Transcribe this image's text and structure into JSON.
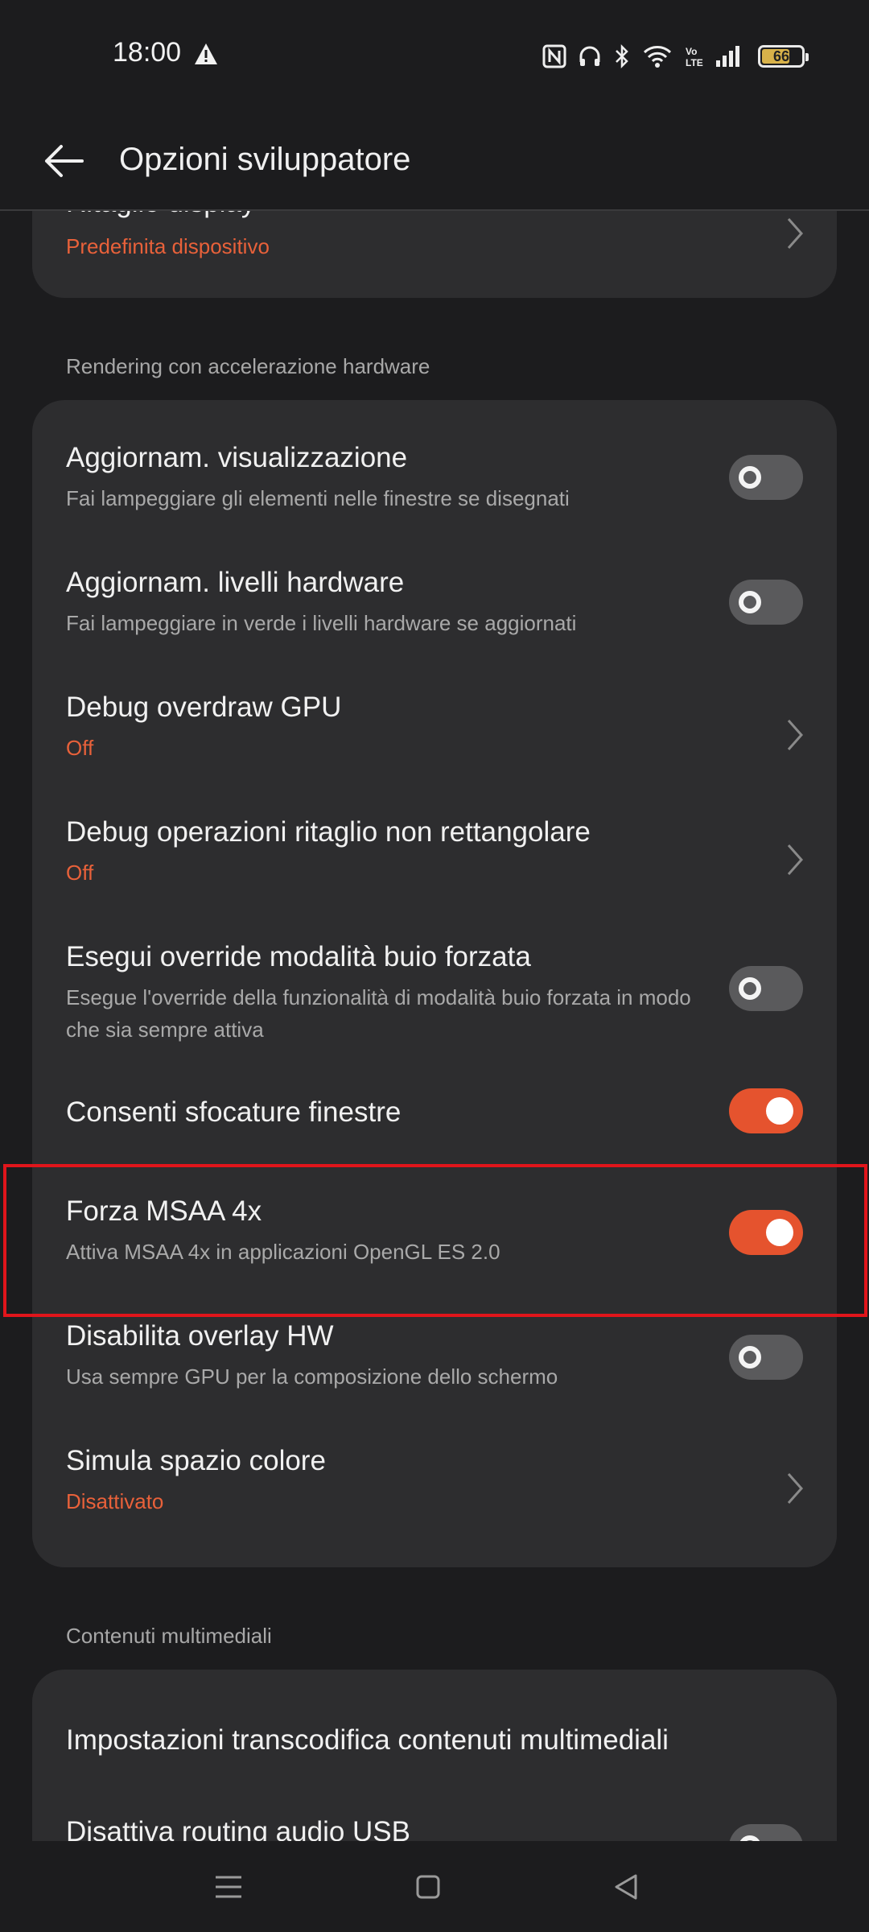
{
  "status_bar": {
    "time": "18:00",
    "battery_level": "66",
    "battery_fraction": 0.66,
    "icons": [
      "warning-icon",
      "nfc-icon",
      "headphones-icon",
      "bluetooth-icon",
      "wifi-icon",
      "volte-icon",
      "signal-icon",
      "battery-icon"
    ]
  },
  "app_bar": {
    "title": "Opzioni sviluppatore",
    "back_icon": "back-arrow-icon"
  },
  "top_card": {
    "title": "Ritaglio display",
    "subtitle": "Predefinita dispositivo"
  },
  "rendering": {
    "header": "Rendering con accelerazione hardware",
    "items": [
      {
        "title": "Aggiornam. visualizzazione",
        "subtitle": "Fai lampeggiare gli elementi nelle finestre se disegnati",
        "control": "toggle",
        "on": false
      },
      {
        "title": "Aggiornam. livelli hardware",
        "subtitle": "Fai lampeggiare in verde i livelli hardware se aggiornati",
        "control": "toggle",
        "on": false
      },
      {
        "title": "Debug overdraw GPU",
        "subtitle": "Off",
        "control": "chevron"
      },
      {
        "title": "Debug operazioni ritaglio non rettangolare",
        "subtitle": "Off",
        "control": "chevron"
      },
      {
        "title": "Esegui override modalità buio forzata",
        "subtitle": "Esegue l'override della funzionalità di modalità buio forzata in modo che sia sempre attiva",
        "control": "toggle",
        "on": false
      },
      {
        "title": "Consenti sfocature finestre",
        "subtitle": "",
        "control": "toggle",
        "on": true
      },
      {
        "title": "Forza MSAA 4x",
        "subtitle": "Attiva MSAA 4x in applicazioni OpenGL ES 2.0",
        "control": "toggle",
        "on": true
      },
      {
        "title": "Disabilita overlay HW",
        "subtitle": "Usa sempre GPU per la composizione dello schermo",
        "control": "toggle",
        "on": false
      },
      {
        "title": "Simula spazio colore",
        "subtitle": "Disattivato",
        "control": "chevron"
      }
    ]
  },
  "media": {
    "header": "Contenuti multimediali",
    "items": [
      {
        "title": "Impostazioni transcodifica contenuti multimediali"
      },
      {
        "title": "Disattiva routing audio USB"
      }
    ]
  },
  "colors": {
    "accent": "#e8613a",
    "toggle_on": "#e5532e",
    "toggle_off": "#5a5a5c",
    "card": "#2d2d2f",
    "background": "#1c1c1e",
    "highlight": "#e0151b"
  },
  "nav_bar": {
    "icons": [
      "menu-icon",
      "home-icon",
      "back-icon"
    ]
  }
}
